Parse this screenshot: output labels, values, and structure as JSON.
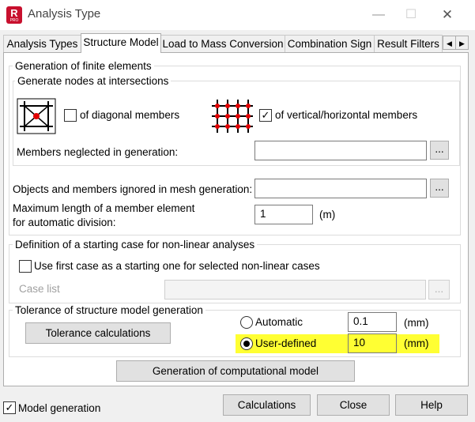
{
  "window": {
    "title": "Analysis Type",
    "logo_letter": "R",
    "logo_sub": "PRO",
    "minimize_glyph": "—",
    "maximize_glyph": "☐",
    "close_glyph": "✕"
  },
  "tabs": [
    {
      "label": "Analysis Types"
    },
    {
      "label": "Structure Model",
      "active": true
    },
    {
      "label": "Load to Mass Conversion"
    },
    {
      "label": "Combination Sign"
    },
    {
      "label": "Result Filters"
    }
  ],
  "tab_scroll": {
    "left": "◀",
    "right": "▶"
  },
  "generation": {
    "title": "Generation of finite elements",
    "nodes_title": "Generate nodes at intersections",
    "diagonal": {
      "label": "of diagonal members",
      "checked": false
    },
    "vertical": {
      "label": "of vertical/horizontal members",
      "checked": true,
      "check_glyph": "✓"
    },
    "neglected_label": "Members neglected in generation:",
    "neglected_value": "",
    "browse_label": "..."
  },
  "ignored": {
    "label": "Objects and members ignored in mesh generation:",
    "value": "",
    "browse_label": "..."
  },
  "max_length": {
    "label_line1": "Maximum length of a member element",
    "label_line2": "for automatic division:",
    "value": "1",
    "unit": "(m)"
  },
  "starting_case": {
    "title": "Definition of a starting case for non-linear analyses",
    "use_first": {
      "label": "Use first case as a starting one for selected non-linear cases",
      "checked": false
    },
    "case_list_label": "Case list",
    "case_list_value": "",
    "browse_label": "..."
  },
  "tolerance": {
    "title": "Tolerance of structure model generation",
    "calc_button": "Tolerance calculations",
    "automatic": {
      "label": "Automatic",
      "value": "0.1",
      "unit": "(mm)",
      "selected": false
    },
    "user_defined": {
      "label": "User-defined",
      "value": "10",
      "unit": "(mm)",
      "selected": true
    },
    "highlight_color": "#ffff33"
  },
  "generate_button": "Generation of computational model",
  "footer": {
    "model_generation": {
      "label": "Model generation",
      "checked": true,
      "check_glyph": "✓"
    },
    "calculations": "Calculations",
    "close": "Close",
    "help": "Help"
  },
  "colors": {
    "grid_red": "#e00000",
    "grid_black": "#000000"
  }
}
